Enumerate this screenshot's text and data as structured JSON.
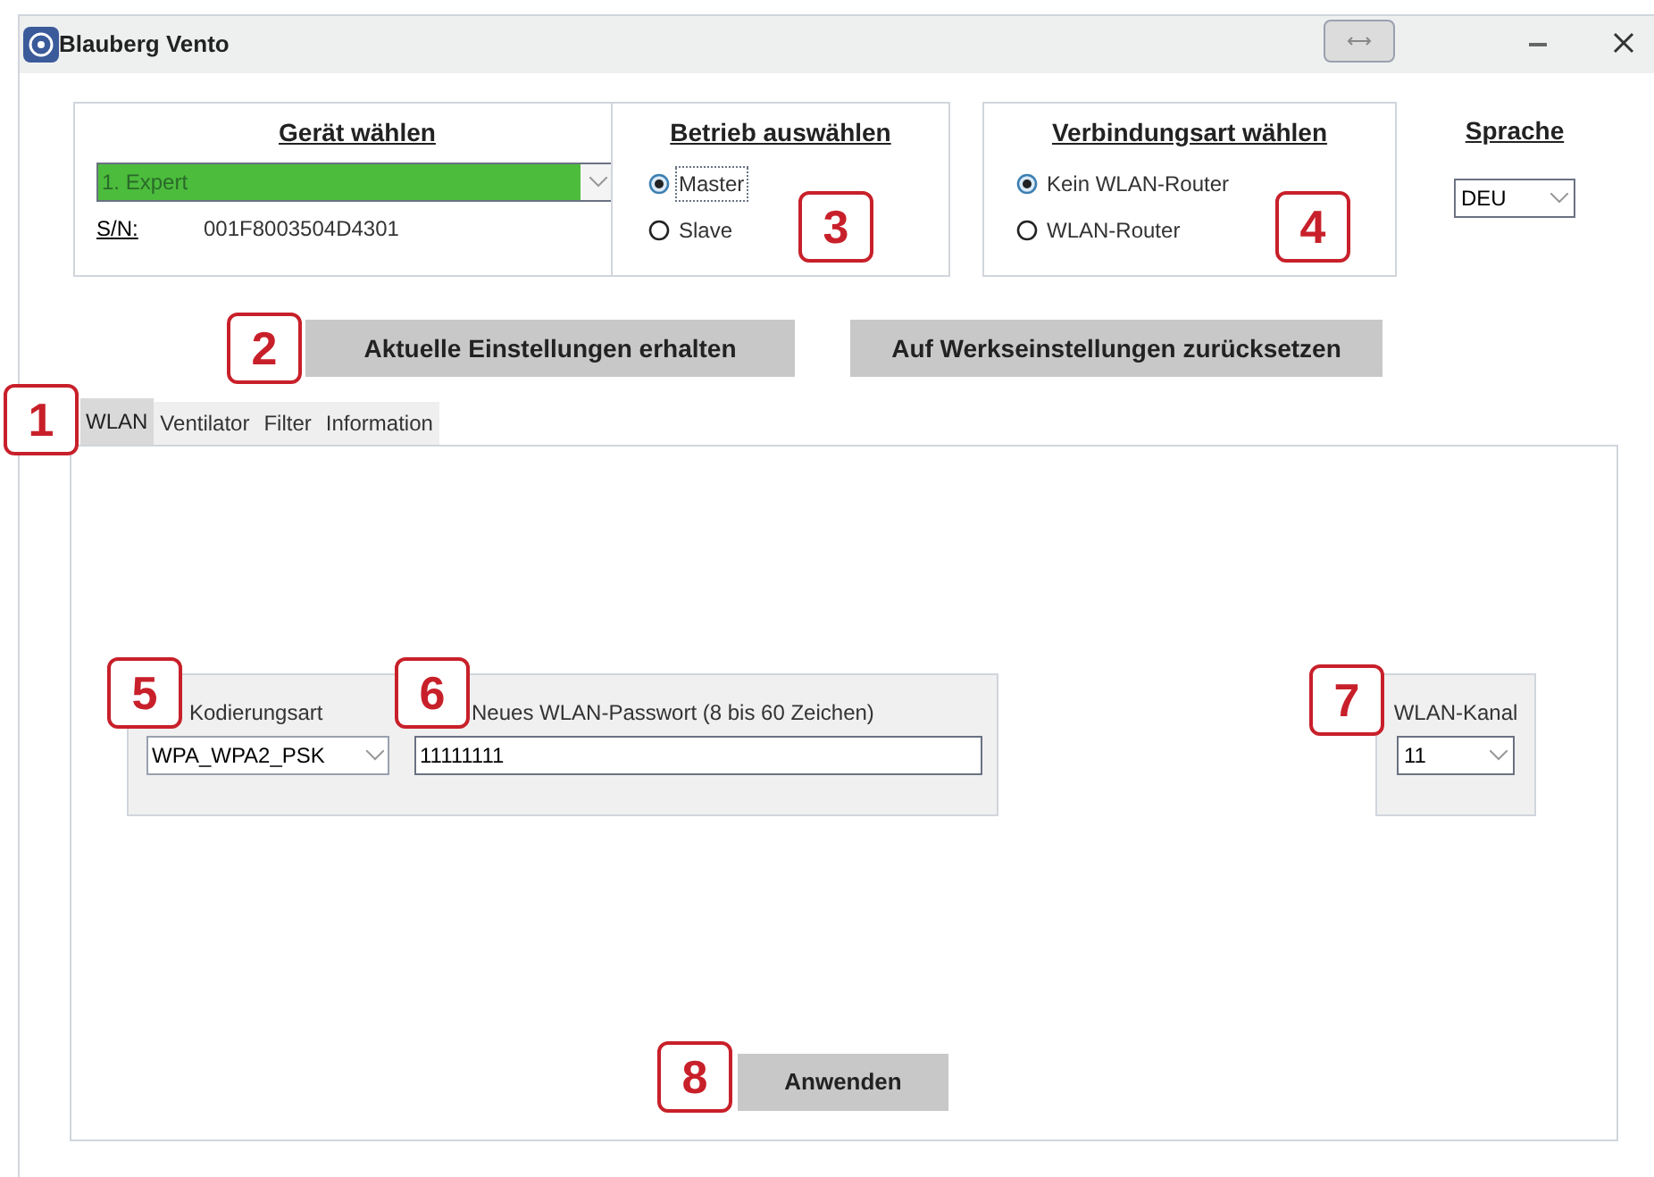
{
  "window": {
    "title": "Blauberg Vento"
  },
  "device_group": {
    "title": "Gerät wählen",
    "device": "1. Expert",
    "serial_label": "S/N:",
    "serial": "001F8003504D4301"
  },
  "operation_group": {
    "title": "Betrieb auswählen",
    "options": [
      {
        "label": "Master",
        "selected": true
      },
      {
        "label": "Slave",
        "selected": false
      }
    ]
  },
  "connection_group": {
    "title": "Verbindungsart wählen",
    "options": [
      {
        "label": "Kein WLAN-Router",
        "selected": true
      },
      {
        "label": "WLAN-Router",
        "selected": false
      }
    ]
  },
  "language": {
    "title": "Sprache",
    "value": "DEU"
  },
  "buttons": [
    "Aktuelle Einstellungen erhalten",
    "Auf Werkseinstellungen zurücksetzen"
  ],
  "tabs": [
    {
      "label": "WLAN",
      "selected": true
    },
    {
      "label": "Ventilator",
      "selected": false
    },
    {
      "label": "Filter",
      "selected": false
    },
    {
      "label": "Information",
      "selected": false
    }
  ],
  "wlan": {
    "encoding": {
      "label": "Kodierungsart",
      "value": "WPA_WPA2_PSK"
    },
    "password": {
      "label": "Neues WLAN-Passwort (8 bis 60 Zeichen)",
      "value": "11111111"
    },
    "channel": {
      "label": "WLAN-Kanal",
      "value": "11"
    }
  },
  "apply_button": "Anwenden",
  "callouts": [
    "1",
    "2",
    "3",
    "4",
    "5",
    "6",
    "7",
    "8"
  ]
}
